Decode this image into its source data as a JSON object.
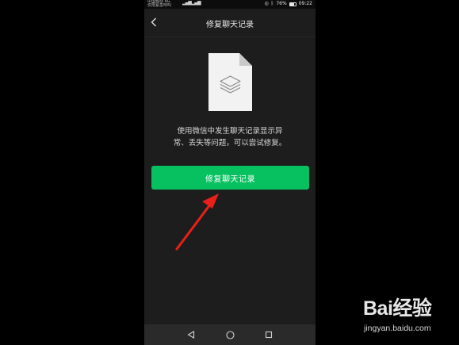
{
  "status_bar": {
    "carrier_line1": "中国移动 4G",
    "carrier_line2": "仅限紧急呼叫",
    "battery_percent": "76%",
    "time": "09:22"
  },
  "navbar": {
    "back_icon": "chevron-left-icon",
    "title": "修复聊天记录"
  },
  "main": {
    "illustration_icon": "file-layers-icon",
    "description_line1": "使用微信中发生聊天记录显示异",
    "description_line2": "常、丢失等问题，可以尝试修复。",
    "repair_button_label": "修复聊天记录"
  },
  "system_nav": {
    "back_icon": "triangle-back-icon",
    "home_icon": "circle-home-icon",
    "recents_icon": "square-recents-icon"
  },
  "overlay": {
    "annotation": "red-arrow-icon"
  },
  "watermark": {
    "logo": "Bai经验",
    "url": "jingyan.baidu.com"
  },
  "colors": {
    "accent": "#07c160",
    "background": "#1d1d1d",
    "annotation_red": "#e8201a"
  }
}
